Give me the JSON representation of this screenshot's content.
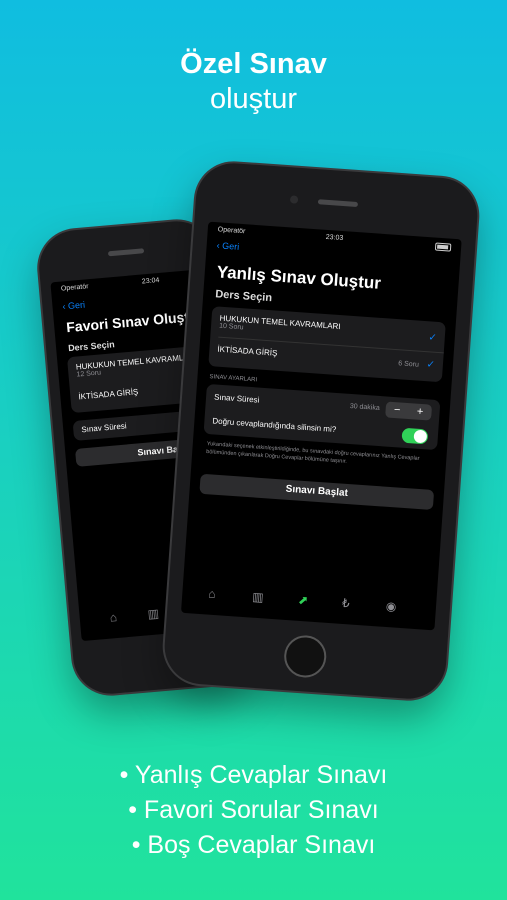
{
  "headline": {
    "line1": "Özel Sınav",
    "line2": "oluştur"
  },
  "back_phone": {
    "status": {
      "operator": "Operatör",
      "time": "23:04"
    },
    "back_label": "Geri",
    "title": "Favori Sınav Oluşturma",
    "section": "Ders Seçin",
    "courses": [
      {
        "name": "HUKUKUN TEMEL KAVRAMLARI",
        "count": "12 Soru"
      },
      {
        "name": "İKTİSADA GİRİŞ",
        "count": ""
      }
    ],
    "duration_label": "Sınav Süresi",
    "duration_value": "30",
    "start_button": "Sınavı Başlat"
  },
  "front_phone": {
    "status": {
      "operator": "Operatör",
      "time": "23:03"
    },
    "back_label": "Geri",
    "title": "Yanlış Sınav Oluştur",
    "section": "Ders Seçin",
    "courses": [
      {
        "name": "HUKUKUN TEMEL KAVRAMLARI",
        "count": "10 Soru",
        "check": "✓"
      },
      {
        "name": "İKTİSADA GİRİŞ",
        "count": "6 Soru",
        "check": "✓"
      }
    ],
    "settings_header": "SINAV AYARLARI",
    "duration_label": "Sınav Süresi",
    "duration_value": "30 dakika",
    "stepper_minus": "−",
    "stepper_plus": "+",
    "delete_toggle_label": "Doğru cevaplandığında silinsin mi?",
    "footnote": "Yukarıdaki seçenek etkinleştirildiğinde, bu sınavdaki doğru cevaplarınız Yanlış Cevaplar bölümünden çıkarılarak Doğru Cevaplar bölümüne taşınır.",
    "start_button": "Sınavı Başlat",
    "tabs": [
      {
        "icon": "home-icon",
        "glyph": "⌂"
      },
      {
        "icon": "library-icon",
        "glyph": "▥"
      },
      {
        "icon": "chart-icon",
        "glyph": "⬈"
      },
      {
        "icon": "lira-icon",
        "glyph": "₺"
      },
      {
        "icon": "profile-icon",
        "glyph": "◉"
      }
    ]
  },
  "bullets": [
    "• Yanlış Cevaplar Sınavı",
    "• Favori Sorular Sınavı",
    "• Boş Cevaplar Sınavı"
  ]
}
